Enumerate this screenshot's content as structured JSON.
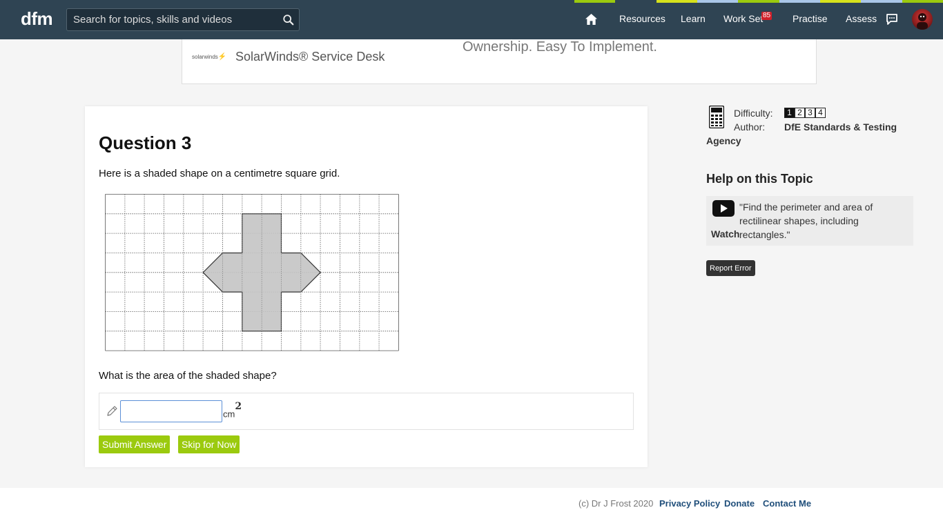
{
  "header": {
    "logo": "dfm",
    "search_placeholder": "Search for topics, skills and videos",
    "stripe_colors": [
      "#9bca0e",
      "#2f4453",
      "#d7e21c",
      "#a9c6e8",
      "#9bca0e",
      "#a9c6e8",
      "#d7e21c",
      "#a9c6e8",
      "#9bca0e"
    ],
    "nav": {
      "resources": "Resources",
      "learn": "Learn",
      "work_set": "Work Set",
      "work_set_badge": "85",
      "practise": "Practise",
      "assess": "Assess"
    }
  },
  "ad": {
    "logo_text": "solarwinds",
    "title": "SolarWinds® Service Desk",
    "text": "Ownership. Easy To Implement."
  },
  "question": {
    "title": "Question 3",
    "prompt": "Here is a shaded shape on a centimetre square grid.",
    "question_text": "What is the area of the shaded shape?",
    "answer_value": "",
    "unit": "cm",
    "unit_power": "2",
    "submit_label": "Submit Answer",
    "skip_label": "Skip for Now"
  },
  "figure": {
    "grid_columns": 15,
    "grid_rows": 8,
    "shape_fill": "#c4c4c4",
    "shape_vertices": [
      [
        7,
        1
      ],
      [
        9,
        1
      ],
      [
        9,
        3
      ],
      [
        10,
        3
      ],
      [
        11,
        4
      ],
      [
        10,
        5
      ],
      [
        9,
        5
      ],
      [
        9,
        7
      ],
      [
        7,
        7
      ],
      [
        7,
        5
      ],
      [
        6,
        5
      ],
      [
        5,
        4
      ],
      [
        6,
        3
      ],
      [
        7,
        3
      ]
    ]
  },
  "sidebar": {
    "difficulty_label": "Difficulty:",
    "difficulty_levels": [
      "1",
      "2",
      "3",
      "4"
    ],
    "difficulty_selected": "1",
    "author_label": "Author:",
    "author_line1": "DfE Standards & Testing",
    "author_line2": "Agency",
    "help_title": "Help on this Topic",
    "help_video_text": "\"Find the perimeter and area of rectilinear shapes, including rectangles.\"",
    "watch_label": "Watch",
    "report_label": "Report Error"
  },
  "footer": {
    "copyright": "(c) Dr J Frost 2020",
    "privacy": "Privacy Policy",
    "donate": "Donate",
    "contact": "Contact Me"
  }
}
